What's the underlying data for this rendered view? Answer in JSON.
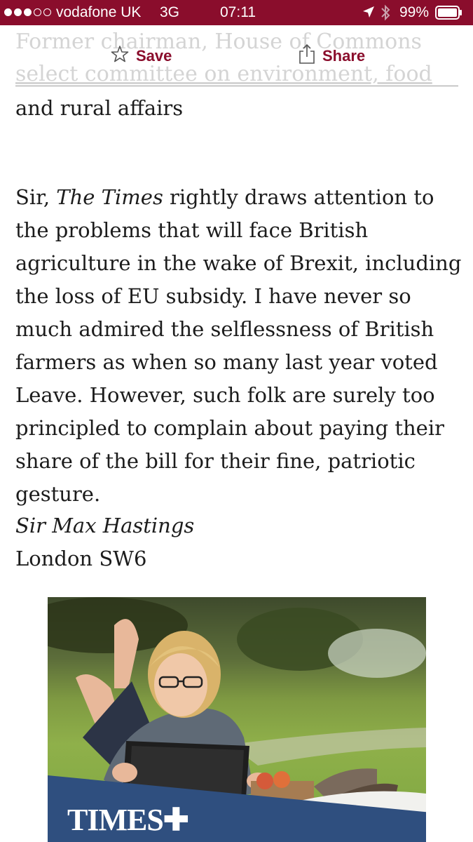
{
  "status_bar": {
    "carrier": "vodafone UK",
    "network": "3G",
    "time": "07:11",
    "battery": "99%",
    "signal_strength": 3,
    "signal_max": 5
  },
  "header": {
    "ghost_line_1": "Former chairman, House of Commons",
    "ghost_line_2": "select committee on environment, food",
    "subtitle_end": "and rural affairs"
  },
  "toolbar": {
    "save_label": "Save",
    "share_label": "Share"
  },
  "letter": {
    "salutation": "Sir, ",
    "publication": "The Times",
    "body": " rightly draws attention to the problems that will face British agriculture in the wake of Brexit, including the loss of EU subsidy. I have never so much admired the selflessness of British farmers as when so many last year voted Leave. However, such folk are surely too principled to complain about paying their share of the bill for their fine, patriotic gesture.",
    "signature": "Sir Max Hastings",
    "location": "London SW6"
  },
  "ad": {
    "brand": "TIMES"
  },
  "colors": {
    "brand": "#8a0d2c",
    "ad_banner": "#2f4f7f"
  }
}
